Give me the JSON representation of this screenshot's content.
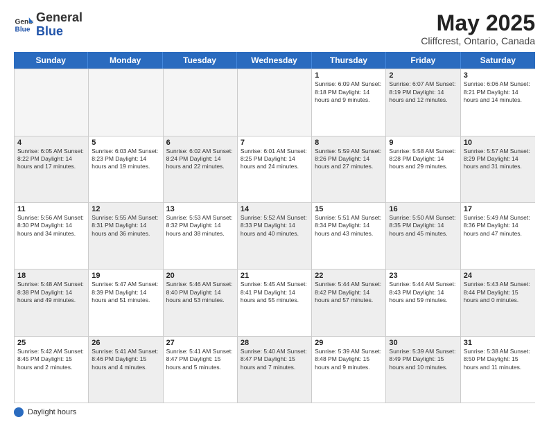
{
  "header": {
    "logo_general": "General",
    "logo_blue": "Blue",
    "month_title": "May 2025",
    "subtitle": "Cliffcrest, Ontario, Canada"
  },
  "days_of_week": [
    "Sunday",
    "Monday",
    "Tuesday",
    "Wednesday",
    "Thursday",
    "Friday",
    "Saturday"
  ],
  "footer": {
    "label": "Daylight hours"
  },
  "weeks": [
    {
      "cells": [
        {
          "day": "",
          "info": "",
          "empty": true
        },
        {
          "day": "",
          "info": "",
          "empty": true
        },
        {
          "day": "",
          "info": "",
          "empty": true
        },
        {
          "day": "",
          "info": "",
          "empty": true
        },
        {
          "day": "1",
          "info": "Sunrise: 6:09 AM\nSunset: 8:18 PM\nDaylight: 14 hours\nand 9 minutes.",
          "shaded": false
        },
        {
          "day": "2",
          "info": "Sunrise: 6:07 AM\nSunset: 8:19 PM\nDaylight: 14 hours\nand 12 minutes.",
          "shaded": true
        },
        {
          "day": "3",
          "info": "Sunrise: 6:06 AM\nSunset: 8:21 PM\nDaylight: 14 hours\nand 14 minutes.",
          "shaded": false
        }
      ]
    },
    {
      "cells": [
        {
          "day": "4",
          "info": "Sunrise: 6:05 AM\nSunset: 8:22 PM\nDaylight: 14 hours\nand 17 minutes.",
          "shaded": true
        },
        {
          "day": "5",
          "info": "Sunrise: 6:03 AM\nSunset: 8:23 PM\nDaylight: 14 hours\nand 19 minutes.",
          "shaded": false
        },
        {
          "day": "6",
          "info": "Sunrise: 6:02 AM\nSunset: 8:24 PM\nDaylight: 14 hours\nand 22 minutes.",
          "shaded": true
        },
        {
          "day": "7",
          "info": "Sunrise: 6:01 AM\nSunset: 8:25 PM\nDaylight: 14 hours\nand 24 minutes.",
          "shaded": false
        },
        {
          "day": "8",
          "info": "Sunrise: 5:59 AM\nSunset: 8:26 PM\nDaylight: 14 hours\nand 27 minutes.",
          "shaded": true
        },
        {
          "day": "9",
          "info": "Sunrise: 5:58 AM\nSunset: 8:28 PM\nDaylight: 14 hours\nand 29 minutes.",
          "shaded": false
        },
        {
          "day": "10",
          "info": "Sunrise: 5:57 AM\nSunset: 8:29 PM\nDaylight: 14 hours\nand 31 minutes.",
          "shaded": true
        }
      ]
    },
    {
      "cells": [
        {
          "day": "11",
          "info": "Sunrise: 5:56 AM\nSunset: 8:30 PM\nDaylight: 14 hours\nand 34 minutes.",
          "shaded": false
        },
        {
          "day": "12",
          "info": "Sunrise: 5:55 AM\nSunset: 8:31 PM\nDaylight: 14 hours\nand 36 minutes.",
          "shaded": true
        },
        {
          "day": "13",
          "info": "Sunrise: 5:53 AM\nSunset: 8:32 PM\nDaylight: 14 hours\nand 38 minutes.",
          "shaded": false
        },
        {
          "day": "14",
          "info": "Sunrise: 5:52 AM\nSunset: 8:33 PM\nDaylight: 14 hours\nand 40 minutes.",
          "shaded": true
        },
        {
          "day": "15",
          "info": "Sunrise: 5:51 AM\nSunset: 8:34 PM\nDaylight: 14 hours\nand 43 minutes.",
          "shaded": false
        },
        {
          "day": "16",
          "info": "Sunrise: 5:50 AM\nSunset: 8:35 PM\nDaylight: 14 hours\nand 45 minutes.",
          "shaded": true
        },
        {
          "day": "17",
          "info": "Sunrise: 5:49 AM\nSunset: 8:36 PM\nDaylight: 14 hours\nand 47 minutes.",
          "shaded": false
        }
      ]
    },
    {
      "cells": [
        {
          "day": "18",
          "info": "Sunrise: 5:48 AM\nSunset: 8:38 PM\nDaylight: 14 hours\nand 49 minutes.",
          "shaded": true
        },
        {
          "day": "19",
          "info": "Sunrise: 5:47 AM\nSunset: 8:39 PM\nDaylight: 14 hours\nand 51 minutes.",
          "shaded": false
        },
        {
          "day": "20",
          "info": "Sunrise: 5:46 AM\nSunset: 8:40 PM\nDaylight: 14 hours\nand 53 minutes.",
          "shaded": true
        },
        {
          "day": "21",
          "info": "Sunrise: 5:45 AM\nSunset: 8:41 PM\nDaylight: 14 hours\nand 55 minutes.",
          "shaded": false
        },
        {
          "day": "22",
          "info": "Sunrise: 5:44 AM\nSunset: 8:42 PM\nDaylight: 14 hours\nand 57 minutes.",
          "shaded": true
        },
        {
          "day": "23",
          "info": "Sunrise: 5:44 AM\nSunset: 8:43 PM\nDaylight: 14 hours\nand 59 minutes.",
          "shaded": false
        },
        {
          "day": "24",
          "info": "Sunrise: 5:43 AM\nSunset: 8:44 PM\nDaylight: 15 hours\nand 0 minutes.",
          "shaded": true
        }
      ]
    },
    {
      "cells": [
        {
          "day": "25",
          "info": "Sunrise: 5:42 AM\nSunset: 8:45 PM\nDaylight: 15 hours\nand 2 minutes.",
          "shaded": false
        },
        {
          "day": "26",
          "info": "Sunrise: 5:41 AM\nSunset: 8:46 PM\nDaylight: 15 hours\nand 4 minutes.",
          "shaded": true
        },
        {
          "day": "27",
          "info": "Sunrise: 5:41 AM\nSunset: 8:47 PM\nDaylight: 15 hours\nand 5 minutes.",
          "shaded": false
        },
        {
          "day": "28",
          "info": "Sunrise: 5:40 AM\nSunset: 8:47 PM\nDaylight: 15 hours\nand 7 minutes.",
          "shaded": true
        },
        {
          "day": "29",
          "info": "Sunrise: 5:39 AM\nSunset: 8:48 PM\nDaylight: 15 hours\nand 9 minutes.",
          "shaded": false
        },
        {
          "day": "30",
          "info": "Sunrise: 5:39 AM\nSunset: 8:49 PM\nDaylight: 15 hours\nand 10 minutes.",
          "shaded": true
        },
        {
          "day": "31",
          "info": "Sunrise: 5:38 AM\nSunset: 8:50 PM\nDaylight: 15 hours\nand 11 minutes.",
          "shaded": false
        }
      ]
    }
  ]
}
